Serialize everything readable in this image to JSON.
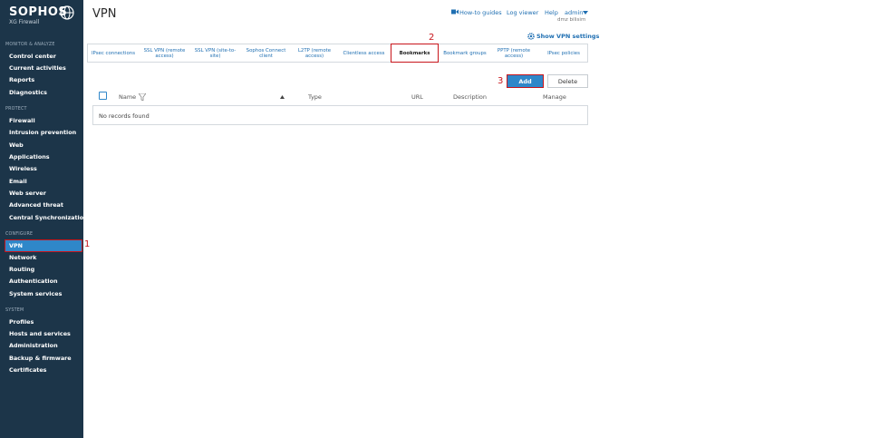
{
  "brand": {
    "name": "SOPHOS",
    "product": "XG Firewall"
  },
  "sidebar": {
    "sections": [
      {
        "label": "MONITOR & ANALYZE",
        "items": [
          "Control center",
          "Current activities",
          "Reports",
          "Diagnostics"
        ]
      },
      {
        "label": "PROTECT",
        "items": [
          "Firewall",
          "Intrusion prevention",
          "Web",
          "Applications",
          "Wireless",
          "Email",
          "Web server",
          "Advanced threat",
          "Central Synchronization"
        ]
      },
      {
        "label": "CONFIGURE",
        "items": [
          "VPN",
          "Network",
          "Routing",
          "Authentication",
          "System services"
        ]
      },
      {
        "label": "SYSTEM",
        "items": [
          "Profiles",
          "Hosts and services",
          "Administration",
          "Backup & firmware",
          "Certificates"
        ]
      }
    ],
    "active": "VPN"
  },
  "header": {
    "title": "VPN",
    "links": {
      "howto": "How-to guides",
      "log": "Log viewer",
      "help": "Help",
      "admin": "admin"
    },
    "user_sub": "dmz bilisim",
    "show_settings": "Show VPN settings"
  },
  "tabs": [
    "IPsec connections",
    "SSL VPN (remote access)",
    "SSL VPN (site-to-site)",
    "Sophos Connect client",
    "L2TP (remote access)",
    "Clientless access",
    "Bookmarks",
    "Bookmark groups",
    "PPTP (remote access)",
    "IPsec policies"
  ],
  "active_tab": "Bookmarks",
  "buttons": {
    "add": "Add",
    "delete": "Delete"
  },
  "table": {
    "columns": {
      "name": "Name",
      "type": "Type",
      "url": "URL",
      "description": "Description",
      "manage": "Manage"
    },
    "empty": "No records found"
  },
  "annotations": {
    "one": "1",
    "two": "2",
    "three": "3"
  },
  "colors": {
    "sidebar_bg": "#1c3549",
    "accent": "#2f87c9",
    "highlight": "#c8151b",
    "link": "#1f6fb2"
  }
}
